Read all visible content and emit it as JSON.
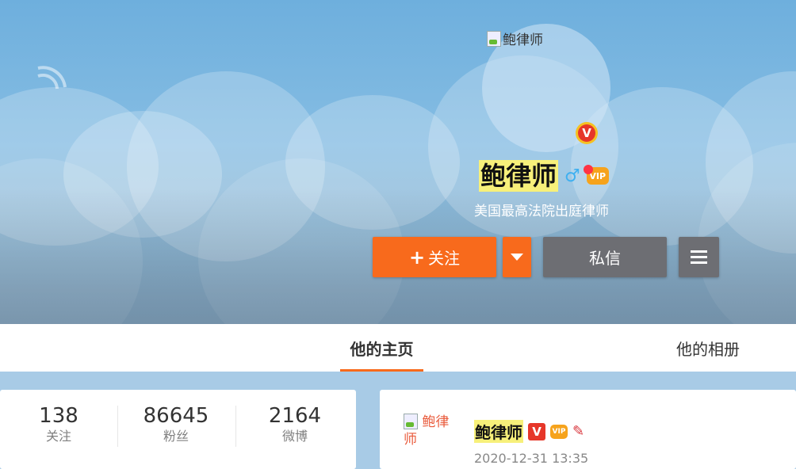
{
  "profile": {
    "avatar_alt": "鲍律师",
    "name": "鲍律师",
    "bio": "美国最高法院出庭律师",
    "verified_badge": "V",
    "gender_symbol": "♂",
    "vip_label": "VIP"
  },
  "actions": {
    "follow_plus": "+",
    "follow_label": "关注",
    "message_label": "私信"
  },
  "tabs": {
    "home": "他的主页",
    "album": "他的相册"
  },
  "stats": [
    {
      "value": "138",
      "label": "关注"
    },
    {
      "value": "86645",
      "label": "粉丝"
    },
    {
      "value": "2164",
      "label": "微博"
    }
  ],
  "feed": {
    "avatar_alt": "鲍律师",
    "author": "鲍律师",
    "verified_badge": "V",
    "vip_label": "VIP",
    "timestamp": "2020-12-31 13:35"
  },
  "colors": {
    "accent": "#f86a1c",
    "button_gray": "#6d6e73",
    "highlight": "#f7f07a"
  },
  "icons": [
    "rss-icon",
    "male-icon",
    "vip-icon",
    "chevron-down-icon",
    "menu-icon",
    "medal-icon"
  ]
}
